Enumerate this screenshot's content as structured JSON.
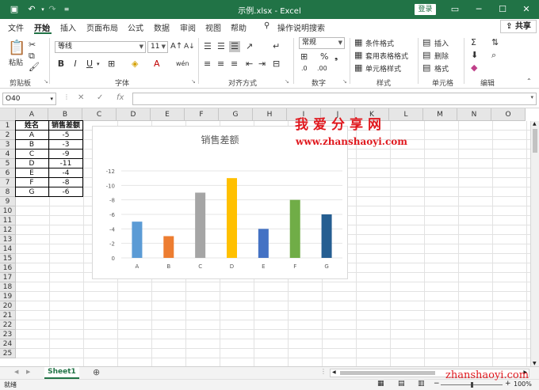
{
  "window": {
    "title": "示例.xlsx  -  Excel",
    "login": "登录"
  },
  "tabs": [
    "文件",
    "开始",
    "插入",
    "页面布局",
    "公式",
    "数据",
    "审阅",
    "视图",
    "帮助"
  ],
  "tell_me": "操作说明搜索",
  "share": "共享",
  "ribbon": {
    "groups": [
      "剪贴板",
      "字体",
      "对齐方式",
      "数字",
      "样式",
      "单元格",
      "编辑"
    ],
    "paste": "粘贴",
    "font_name": "等线",
    "font_size": "11",
    "number_format": "常规",
    "styles": [
      "条件格式",
      "套用表格格式",
      "单元格样式"
    ],
    "cells": [
      "插入",
      "删除",
      "格式"
    ],
    "bold": "B",
    "italic": "I",
    "underline": "U"
  },
  "formula_bar": {
    "name_box": "O40",
    "fx": "fx",
    "formula": ""
  },
  "columns": [
    "A",
    "B",
    "C",
    "D",
    "E",
    "F",
    "G",
    "H",
    "I",
    "J",
    "K",
    "L",
    "M",
    "N",
    "O"
  ],
  "rows": [
    "1",
    "2",
    "3",
    "4",
    "5",
    "6",
    "7",
    "8",
    "9",
    "10",
    "11",
    "12",
    "13",
    "14",
    "15",
    "16",
    "17",
    "18",
    "19",
    "20",
    "21",
    "22",
    "23",
    "24",
    "25"
  ],
  "table": {
    "headers": [
      "姓名",
      "销售差额"
    ],
    "rows": [
      [
        "A",
        "-5"
      ],
      [
        "B",
        "-3"
      ],
      [
        "C",
        "-9"
      ],
      [
        "D",
        "-11"
      ],
      [
        "E",
        "-4"
      ],
      [
        "F",
        "-8"
      ],
      [
        "G",
        "-6"
      ]
    ]
  },
  "chart_data": {
    "type": "bar",
    "title": "销售差额",
    "categories": [
      "A",
      "B",
      "C",
      "D",
      "E",
      "F",
      "G"
    ],
    "values": [
      -5,
      -3,
      -9,
      -11,
      -4,
      -8,
      -6
    ],
    "yticks": [
      "0",
      "-2",
      "-4",
      "-6",
      "-8",
      "-10",
      "-12"
    ],
    "ylim": [
      0,
      -12
    ],
    "y_reversed": true,
    "grid": true,
    "colors": [
      "#5b9bd5",
      "#ed7d31",
      "#a5a5a5",
      "#ffc000",
      "#4472c4",
      "#70ad47",
      "#255e91"
    ]
  },
  "watermark": {
    "name": "我爱分享网",
    "url": "www.zhanshaoyi.com",
    "url2": "zhanshaoyi.com"
  },
  "sheet_tab": "Sheet1",
  "status": {
    "ready": "就绪",
    "zoom": "100%"
  },
  "colors": {
    "accent": "#217346"
  }
}
